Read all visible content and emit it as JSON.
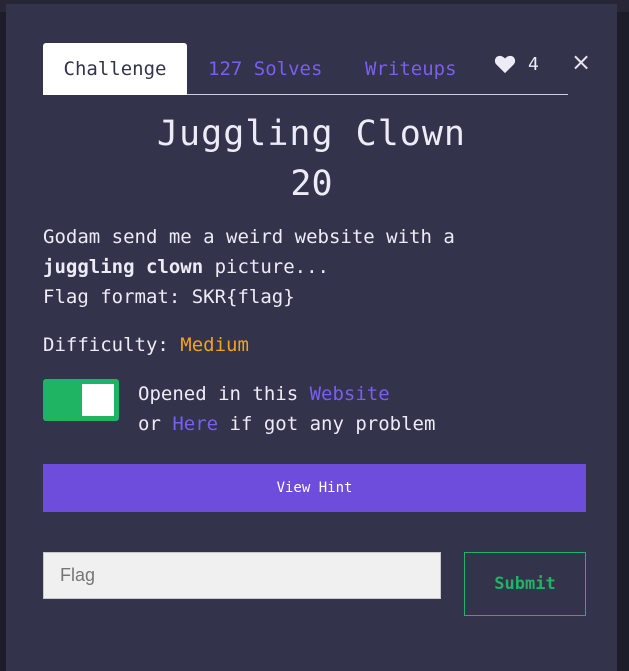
{
  "modal": {
    "close_label": "×",
    "tabs": [
      {
        "label": "Challenge"
      },
      {
        "label": "127 Solves"
      },
      {
        "label": "Writeups"
      }
    ],
    "likes": {
      "count": "4"
    },
    "title": "Juggling Clown",
    "points": "20",
    "description": {
      "line1": "Godam send me a weird website with a",
      "bold": "juggling clown",
      "after_bold": " picture...",
      "line3": "Flag format: SKR{flag}"
    },
    "difficulty": {
      "label": "Difficulty:",
      "value": "Medium"
    },
    "toggle": {
      "on": true
    },
    "opened": {
      "prefix": "Opened in this ",
      "link1": "Website",
      "or_text": "or ",
      "link2": "Here",
      "suffix": " if got any problem"
    },
    "hint_button": "View Hint",
    "flag_input": {
      "placeholder": "Flag",
      "value": ""
    },
    "submit_button": "Submit"
  },
  "colors": {
    "modal_bg": "#33334b",
    "accent_purple": "#7a5ef0",
    "hint_bg": "#6e4cdc",
    "green": "#1eb463",
    "orange": "#f2a21c"
  }
}
